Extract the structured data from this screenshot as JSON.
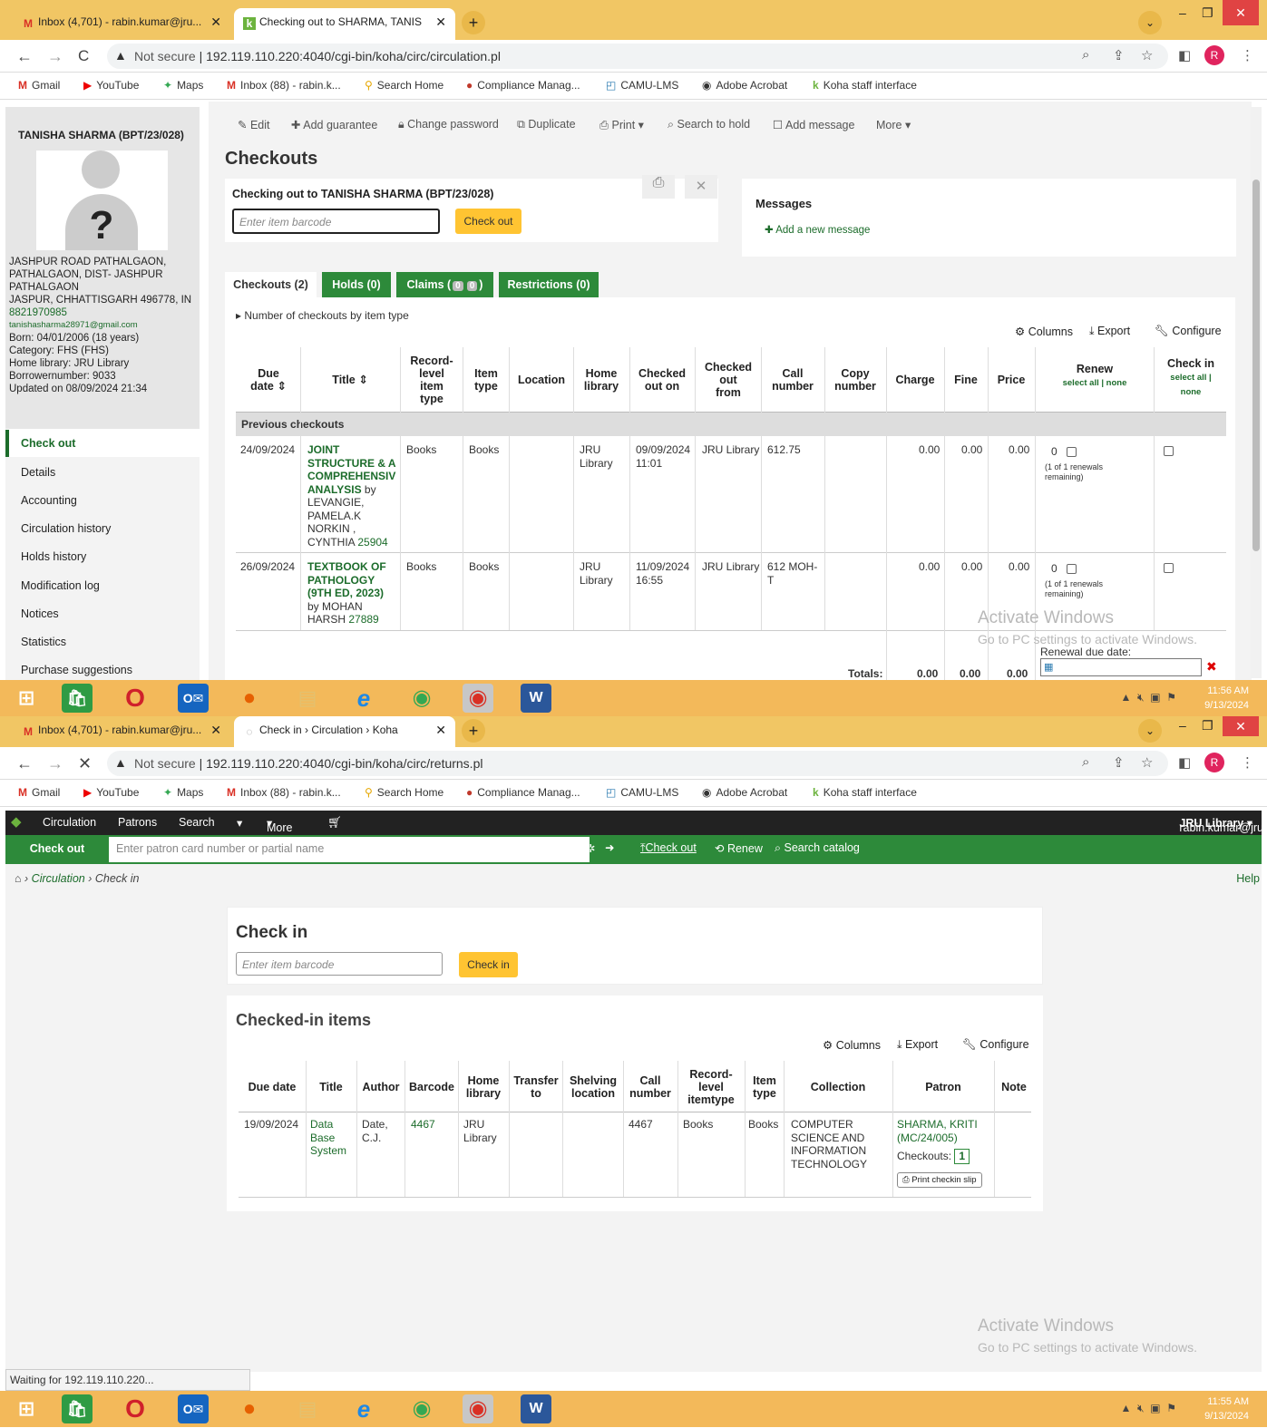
{
  "browser": {
    "tab1_title": "Inbox (4,701) - rabin.kumar@jru...",
    "tab2_title_s1": "Checking out to SHARMA, TANIS",
    "tab2_title_s2": "Check in › Circulation › Koha",
    "not_secure": "Not secure",
    "url_s1": "192.119.110.220:4040/cgi-bin/koha/circ/circulation.pl",
    "url_s2": "192.119.110.220:4040/cgi-bin/koha/circ/returns.pl",
    "profile_letter": "R",
    "bookmarks": [
      "Gmail",
      "YouTube",
      "Maps",
      "Inbox (88) - rabin.k...",
      "Search Home",
      "Compliance Manag...",
      "CAMU-LMS",
      "Adobe Acrobat",
      "Koha staff interface"
    ]
  },
  "patron": {
    "name": "TANISHA SHARMA (BPT/23/028)",
    "address1": "JASHPUR ROAD PATHALGAON,",
    "address2": "PATHALGAON, DIST- JASHPUR",
    "address3": "PATHALGAON",
    "address4": "JASPUR, CHHATTISGARH 496778, IN",
    "phone": "8821970985",
    "email": "tanishasharma28971@gmail.com",
    "born": "Born: 04/01/2006 (18 years)",
    "category": "Category: FHS (FHS)",
    "home_library": "Home library: JRU Library",
    "borrowernumber": "Borrowernumber: 9033",
    "updated": "Updated on 08/09/2024 21:34"
  },
  "sidemenu": [
    "Check out",
    "Details",
    "Accounting",
    "Circulation history",
    "Holds history",
    "Modification log",
    "Notices",
    "Statistics",
    "Purchase suggestions"
  ],
  "toolbar": [
    "Edit",
    "Add guarantee",
    "Change password",
    "Duplicate",
    "Print",
    "Search to hold",
    "Add message",
    "More"
  ],
  "checkout": {
    "page_title": "Checkouts",
    "label": "Checking out to TANISHA SHARMA (BPT/23/028)",
    "placeholder": "Enter item barcode",
    "button": "Check out",
    "messages_title": "Messages",
    "add_message": "Add a new message",
    "tabs": [
      "Checkouts (2)",
      "Holds (0)",
      "Claims (",
      "Restrictions (0)"
    ],
    "claims_counts": [
      "0",
      "0"
    ],
    "claims_close": ")",
    "by_type": "Number of checkouts by item type",
    "columns": "Columns",
    "export": "Export",
    "configure": "Configure",
    "headers": [
      "Due date",
      "Title",
      "Record-level item type",
      "Item type",
      "Location",
      "Home library",
      "Checked out on",
      "Checked out from",
      "Call number",
      "Copy number",
      "Charge",
      "Fine",
      "Price",
      "Renew",
      "Check in"
    ],
    "select_all_none": "select all | none",
    "check_select_all": "select all |",
    "check_none": "none",
    "previous": "Previous checkouts",
    "rows": [
      {
        "due": "24/09/2024",
        "title": "JOINT STRUCTURE & A COMPREHENSIV ANALYSIS",
        "by": "by",
        "author": "LEVANGIE, PAMELA.K NORKIN , CYNTHIA",
        "barcode": "25904",
        "rl_type": "Books",
        "type": "Books",
        "home": "JRU Library",
        "out_on": "09/09/2024 11:01",
        "from": "JRU Library",
        "call": "612.75",
        "charge": "0.00",
        "fine": "0.00",
        "price": "0.00",
        "renew_count": "0",
        "renew_note": "(1 of 1 renewals remaining)"
      },
      {
        "due": "26/09/2024",
        "title": "TEXTBOOK OF PATHOLOGY (9TH ED, 2023)",
        "by": "by",
        "author": "MOHAN HARSH",
        "barcode": "27889",
        "rl_type": "Books",
        "type": "Books",
        "home": "JRU Library",
        "out_on": "11/09/2024 16:55",
        "from": "JRU Library",
        "call": "612 MOH-T",
        "charge": "0.00",
        "fine": "0.00",
        "price": "0.00",
        "renew_count": "0",
        "renew_note": "(1 of 1 renewals remaining)"
      }
    ],
    "totals_label": "Totals:",
    "totals": [
      "0.00",
      "0.00",
      "0.00"
    ],
    "renewal_due": "Renewal due date:"
  },
  "watermark": {
    "line1": "Activate Windows",
    "line2": "Go to PC settings to activate Windows."
  },
  "taskbar": {
    "time1": "11:56 AM",
    "date1": "9/13/2024",
    "time2": "11:55 AM",
    "date2": "9/13/2024"
  },
  "koha": {
    "nav": [
      "Circulation",
      "Patrons",
      "Search",
      "More"
    ],
    "user": "rabin.kumar@jru.edu.in",
    "library": "JRU Library",
    "checkout_tab": "Check out",
    "patron_placeholder": "Enter patron card number or partial name",
    "actions": [
      "Check out",
      "Renew",
      "Search catalog"
    ],
    "crumb": [
      "Circulation",
      "Check in"
    ],
    "help": "Help",
    "checkin_title": "Check in",
    "checkin_button": "Check in",
    "checked_in_title": "Checked-in items",
    "headers": [
      "Due date",
      "Title",
      "Author",
      "Barcode",
      "Home library",
      "Transfer to",
      "Shelving location",
      "Call number",
      "Record-level itemtype",
      "Item type",
      "Collection",
      "Patron",
      "Note"
    ],
    "row": {
      "due": "19/09/2024",
      "title": "Data Base System",
      "author": "Date, C.J.",
      "barcode": "4467",
      "home": "JRU Library",
      "call": "4467",
      "rl_type": "Books",
      "type": "Books",
      "collection": "COMPUTER SCIENCE AND INFORMATION TECHNOLOGY",
      "patron": "SHARMA, KRITI (MC/24/005)",
      "checkouts_label": "Checkouts:",
      "checkouts": "1",
      "print_slip": "Print checkin slip"
    },
    "status": "Waiting for 192.119.110.220..."
  }
}
